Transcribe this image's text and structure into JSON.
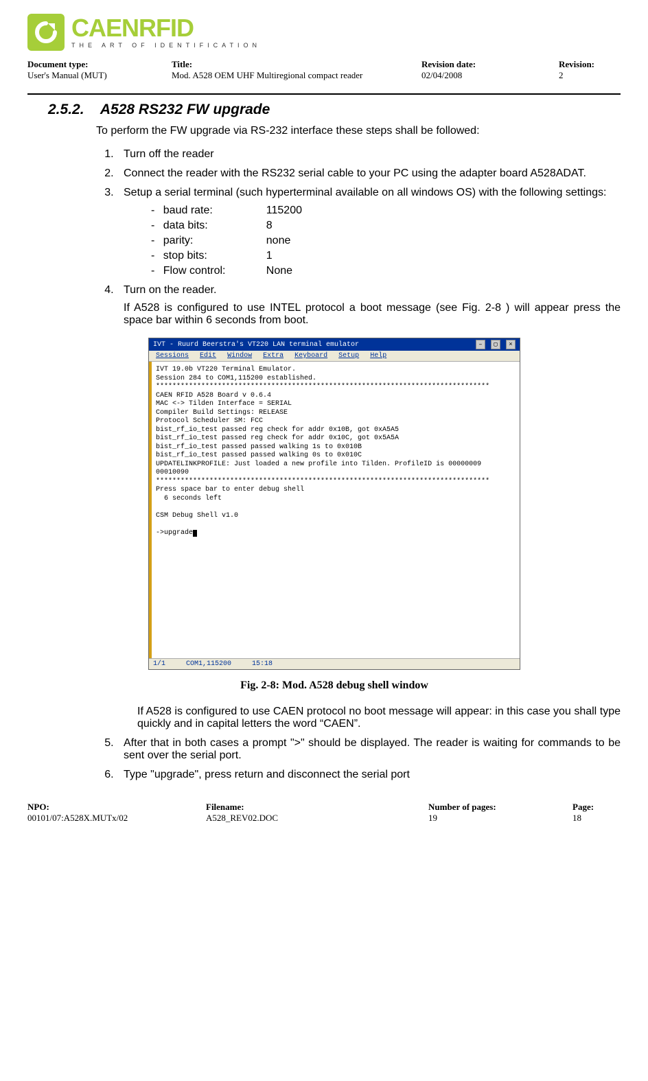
{
  "logo": {
    "main": "CAENRFID",
    "sub": "THE ART OF IDENTIFICATION"
  },
  "header": {
    "doc_type_label": "Document type:",
    "doc_type_value": "User's Manual (MUT)",
    "title_label": "Title:",
    "title_value": "Mod. A528 OEM UHF Multiregional compact reader",
    "rev_date_label": "Revision date:",
    "rev_date_value": "02/04/2008",
    "rev_label": "Revision:",
    "rev_value": "2"
  },
  "section": {
    "number": "2.5.2.",
    "title": "A528 RS232 FW upgrade",
    "intro": "To perform the FW upgrade via RS-232 interface these steps shall be followed:"
  },
  "steps": {
    "s1": "Turn off the reader",
    "s2": "Connect the reader with the RS232 serial cable to your PC using the adapter board A528ADAT.",
    "s3": "Setup a serial terminal (such hyperterminal available on all windows OS) with the following settings:",
    "s4_a": "Turn on the reader.",
    "s4_b": "If A528 is configured to use INTEL protocol a boot message (see Fig. 2-8 ) will appear press the space bar within 6 seconds from boot.",
    "after_fig": "If A528 is configured to use CAEN protocol no boot message will appear:  in this case you shall type quickly and in capital letters the word “CAEN”.",
    "s5": "After that in both cases a prompt \">\" should be displayed. The reader is waiting for commands to be sent over the serial port.",
    "s6": "Type \"upgrade\", press return and disconnect the serial port"
  },
  "settings": {
    "baud_label": "baud rate:",
    "baud_value": "115200",
    "databits_label": "data bits:",
    "databits_value": "8",
    "parity_label": "parity:",
    "parity_value": "none",
    "stopbits_label": "stop bits:",
    "stopbits_value": "1",
    "flow_label": "Flow control:",
    "flow_value": "None"
  },
  "terminal": {
    "title": "IVT - Ruurd Beerstra's VT220 LAN terminal emulator",
    "menu": {
      "m1": "Sessions",
      "m2": "Edit",
      "m3": "Window",
      "m4": "Extra",
      "m5": "Keyboard",
      "m6": "Setup",
      "m7": "Help"
    },
    "lines": "IVT 19.0b VT220 Terminal Emulator.\nSession 284 to COM1,115200 established.\n*********************************************************************************\nCAEN RFID A528 Board v 0.6.4\nMAC <-> Tilden Interface = SERIAL\nCompiler Build Settings: RELEASE\nProtocol Scheduler SM: FCC\nbist_rf_io_test passed reg check for addr 0x10B, got 0xA5A5\nbist_rf_io_test passed reg check for addr 0x10C, got 0x5A5A\nbist_rf_io_test passed passed walking 1s to 0x010B\nbist_rf_io_test passed passed walking 0s to 0x010C\nUPDATELINKPROFILE: Just loaded a new profile into Tilden. ProfileID is 00000009\n00010090\n*********************************************************************************\nPress space bar to enter debug shell\n  6 seconds left\n\nCSM Debug Shell v1.0\n\n->upgrade",
    "status": {
      "s1": "1/1",
      "s2": "COM1,115200",
      "s3": "15:18"
    }
  },
  "figure_caption": "Fig. 2-8: Mod. A528 debug shell window",
  "footer": {
    "npo_label": "NPO:",
    "npo_value": "00101/07:A528X.MUTx/02",
    "filename_label": "Filename:",
    "filename_value": "A528_REV02.DOC",
    "pages_label": "Number of pages:",
    "pages_value": "19",
    "page_label": "Page:",
    "page_value": "18"
  }
}
